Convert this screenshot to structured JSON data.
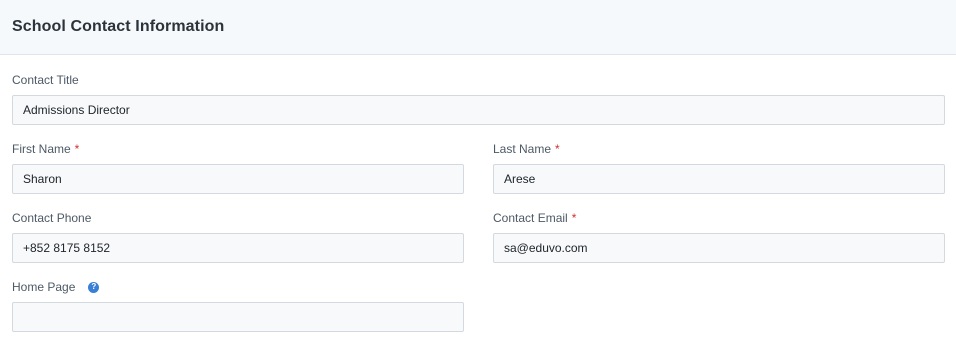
{
  "panel": {
    "title": "School Contact Information"
  },
  "fields": {
    "contact_title": {
      "label": "Contact Title",
      "value": "Admissions Director"
    },
    "first_name": {
      "label": "First Name",
      "required_mark": "*",
      "value": "Sharon"
    },
    "last_name": {
      "label": "Last Name",
      "required_mark": "*",
      "value": "Arese"
    },
    "contact_phone": {
      "label": "Contact Phone",
      "value": "+852 8175 8152"
    },
    "contact_email": {
      "label": "Contact Email",
      "required_mark": "*",
      "value": "sa@eduvo.com"
    },
    "home_page": {
      "label": "Home Page",
      "help_icon_glyph": "?",
      "value": ""
    }
  },
  "icons": {
    "help": "question-circle-icon"
  },
  "colors": {
    "required": "#d0312d",
    "help_icon": "#3a7fd6",
    "header_bg": "#f6f9fc"
  }
}
